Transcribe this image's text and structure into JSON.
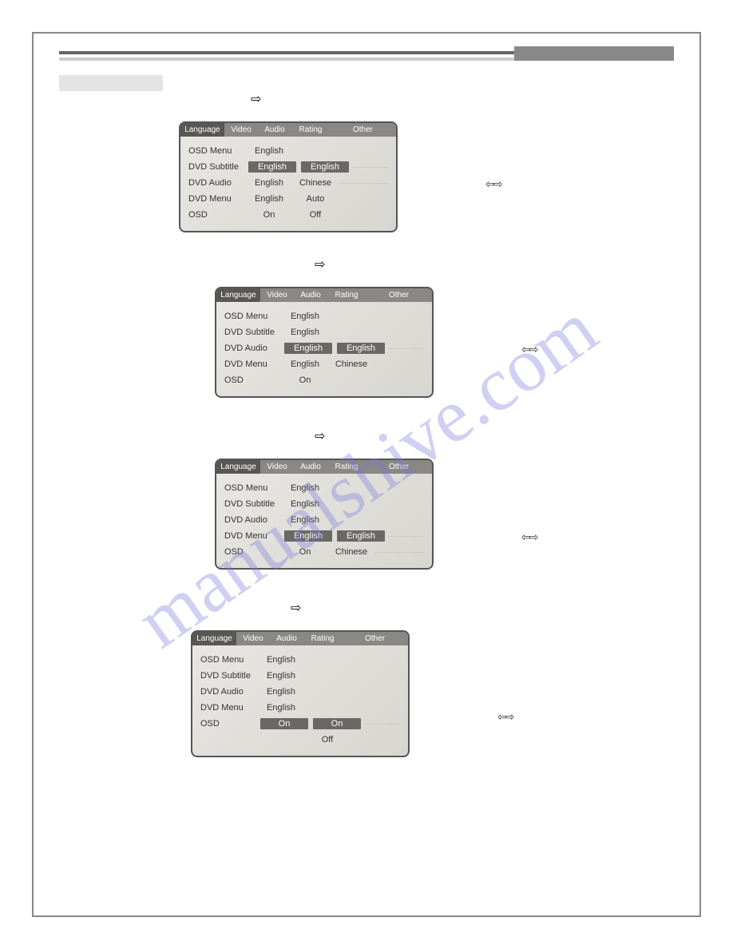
{
  "tabs": {
    "lang": "Language",
    "video": "Video",
    "audio": "Audio",
    "rating": "Rating",
    "other": "Other"
  },
  "labels": {
    "osdmenu": "OSD Menu",
    "subtitle": "DVD Subtitle",
    "audio": "DVD Audio",
    "menu": "DVD Menu",
    "osd": "OSD"
  },
  "vals": {
    "english": "English",
    "chinese": "Chinese",
    "auto": "Auto",
    "on": "On",
    "off": "Off"
  },
  "arrows": {
    "right": "➪",
    "up": "⇧",
    "down": "⇩",
    "updown": "⇦⇨"
  },
  "watermark": "manualshive.com",
  "panels": [
    {
      "highlight": "subtitle",
      "opts": [
        "English",
        "Chinese",
        "Auto",
        "Off"
      ],
      "show": {
        "osdmenu": "English",
        "subtitle": "English",
        "audio": "English",
        "menu": "English",
        "osd": "On"
      }
    },
    {
      "highlight": "audio",
      "opts": [
        "English",
        "Chinese"
      ],
      "show": {
        "osdmenu": "English",
        "subtitle": "English",
        "audio": "English",
        "menu": "English",
        "osd": "On"
      }
    },
    {
      "highlight": "menu",
      "opts": [
        "English",
        "Chinese"
      ],
      "show": {
        "osdmenu": "English",
        "subtitle": "English",
        "audio": "English",
        "menu": "English",
        "osd": "On"
      }
    },
    {
      "highlight": "osd",
      "opts": [
        "On",
        "Off"
      ],
      "show": {
        "osdmenu": "English",
        "subtitle": "English",
        "audio": "English",
        "menu": "English",
        "osd": "On"
      }
    }
  ]
}
